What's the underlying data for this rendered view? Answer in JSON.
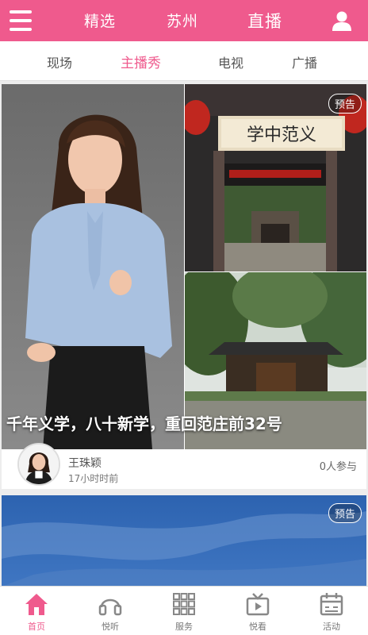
{
  "header": {
    "tabs": [
      {
        "label": "精选",
        "active": false
      },
      {
        "label": "苏州",
        "active": false
      },
      {
        "label": "直播",
        "active": true
      }
    ],
    "menu_icon": "hamburger-icon",
    "user_icon": "user-icon",
    "accent_color": "#ef5a8d"
  },
  "subtabs": [
    {
      "label": "现场",
      "active": false
    },
    {
      "label": "主播秀",
      "active": true
    },
    {
      "label": "电视",
      "active": false
    },
    {
      "label": "广播",
      "active": false
    }
  ],
  "cards": [
    {
      "badge": "预告",
      "title": "千年义学，八十新学，重回范庄前32号",
      "anchor_name": "王珠颖",
      "time_ago": "17小时时前",
      "participants": "0人参与"
    },
    {
      "badge": "预告"
    }
  ],
  "bottom_nav": [
    {
      "label": "首页",
      "icon": "home-icon",
      "active": true
    },
    {
      "label": "悦听",
      "icon": "headphones-icon",
      "active": false
    },
    {
      "label": "服务",
      "icon": "grid-icon",
      "active": false
    },
    {
      "label": "悦看",
      "icon": "tv-icon",
      "active": false
    },
    {
      "label": "活动",
      "icon": "calendar-icon",
      "active": false
    }
  ]
}
